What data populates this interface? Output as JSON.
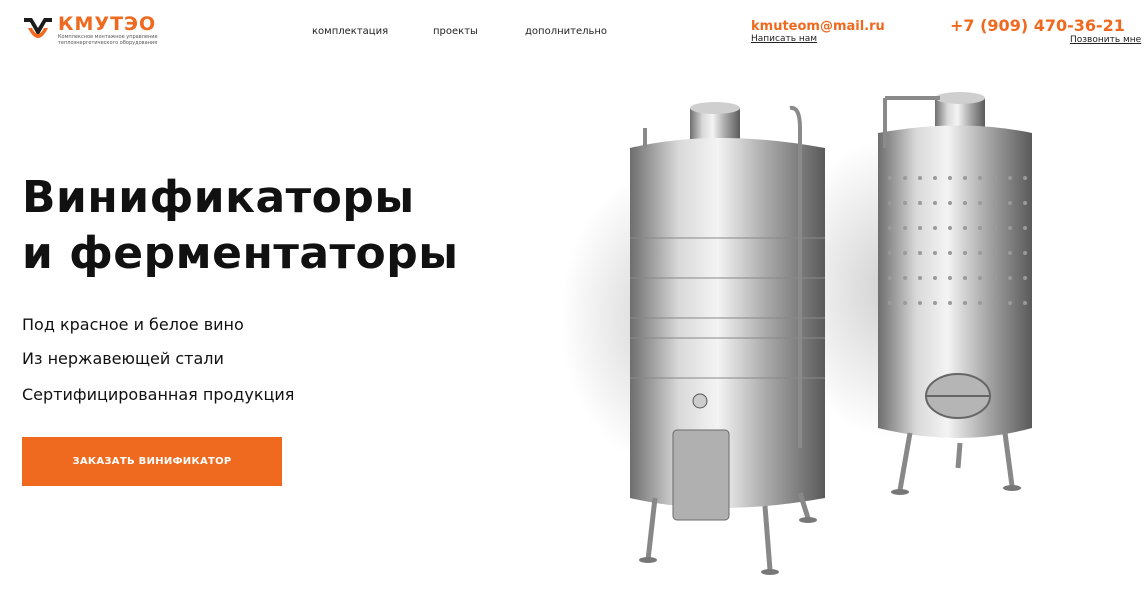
{
  "brand": {
    "name": "КМУТЭО",
    "tagline": "Комплексное монтажное управление теплоэнергетического оборудования",
    "accent_color": "#ef6a1f"
  },
  "nav": {
    "items": [
      {
        "label": "комплектация"
      },
      {
        "label": "проекты"
      },
      {
        "label": "дополнительно"
      }
    ]
  },
  "contacts": {
    "email": "kmuteom@mail.ru",
    "email_action": "Написать нам",
    "phone": "+7 (909) 470-36-21",
    "phone_action": "Позвонить мне"
  },
  "hero": {
    "title_line1": "Винификаторы",
    "title_line2": "и ферментаторы",
    "features": [
      "Под красное и белое вино",
      "Из нержавеющей стали",
      "Сертифицированная продукция"
    ],
    "cta_label": "ЗАКАЗАТЬ ВИНИФИКАТОР"
  }
}
